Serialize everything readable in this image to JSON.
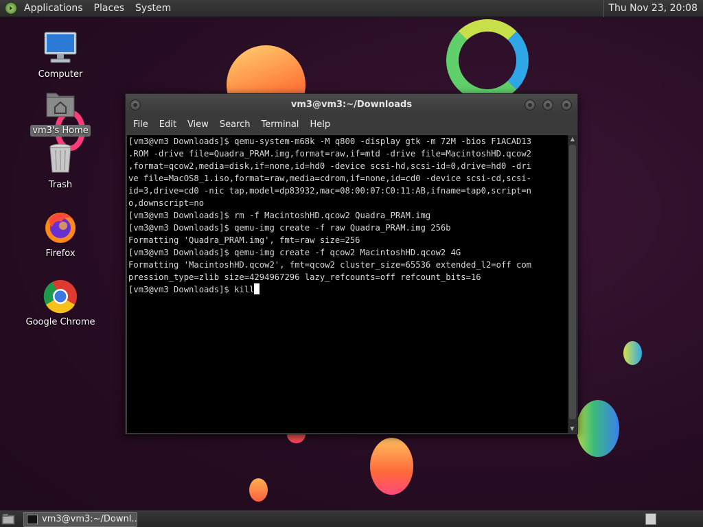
{
  "top_panel": {
    "menus": [
      "Applications",
      "Places",
      "System"
    ],
    "clock": "Thu Nov 23, 20:08"
  },
  "desktop_icons": [
    {
      "label": "Computer",
      "icon": "computer-icon"
    },
    {
      "label": "vm3's Home",
      "icon": "home-folder-icon",
      "selected": true
    },
    {
      "label": "Trash",
      "icon": "trash-icon"
    },
    {
      "label": "Firefox",
      "icon": "firefox-icon"
    },
    {
      "label": "Google Chrome",
      "icon": "chrome-icon"
    }
  ],
  "terminal": {
    "title": "vm3@vm3:~/Downloads",
    "menu": [
      "File",
      "Edit",
      "View",
      "Search",
      "Terminal",
      "Help"
    ],
    "lines": [
      "[vm3@vm3 Downloads]$ qemu-system-m68k -M q800 -display gtk -m 72M -bios F1ACAD13",
      ".ROM -drive file=Quadra_PRAM.img,format=raw,if=mtd -drive file=MacintoshHD.qcow2",
      ",format=qcow2,media=disk,if=none,id=hd0 -device scsi-hd,scsi-id=0,drive=hd0 -dri",
      "ve file=MacOS8_1.iso,format=raw,media=cdrom,if=none,id=cd0 -device scsi-cd,scsi-",
      "id=3,drive=cd0 -nic tap,model=dp83932,mac=08:00:07:C0:11:AB,ifname=tap0,script=n",
      "o,downscript=no",
      "[vm3@vm3 Downloads]$ rm -f MacintoshHD.qcow2 Quadra_PRAM.img",
      "[vm3@vm3 Downloads]$ qemu-img create -f raw Quadra_PRAM.img 256b",
      "Formatting 'Quadra_PRAM.img', fmt=raw size=256",
      "[vm3@vm3 Downloads]$ qemu-img create -f qcow2 MacintoshHD.qcow2 4G",
      "Formatting 'MacintoshHD.qcow2', fmt=qcow2 cluster_size=65536 extended_l2=off com",
      "pression_type=zlib size=4294967296 lazy_refcounts=off refcount_bits=16"
    ],
    "prompt_line": "[vm3@vm3 Downloads]$ kill"
  },
  "taskbar": {
    "task_label": "vm3@vm3:~/Downl..."
  },
  "colors": {
    "panel_bg": "#2b2b2b",
    "terminal_bg": "#000000",
    "terminal_fg": "#d8d8d8",
    "wallpaper_bg": "#2a0f26"
  }
}
